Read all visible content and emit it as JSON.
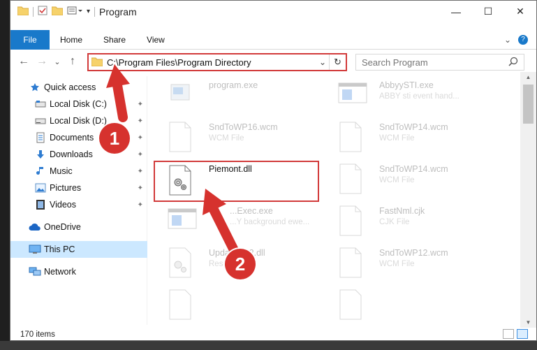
{
  "window": {
    "title": "Program",
    "minimize_glyph": "—",
    "maximize_glyph": "☐",
    "close_glyph": "✕"
  },
  "ribbon": {
    "tabs": [
      "File",
      "Home",
      "Share",
      "View"
    ],
    "collapse_glyph": "⌄",
    "help_glyph": "?"
  },
  "nav": {
    "back_glyph": "←",
    "forward_glyph": "→",
    "recent_glyph": "⌄",
    "up_glyph": "↑",
    "address": "C:\\Program Files\\Program Directory",
    "dropdown_glyph": "⌄",
    "refresh_glyph": "↻",
    "search_placeholder": "Search Program"
  },
  "sidebar": {
    "pin_glyph": "📌",
    "items": [
      {
        "label": "Quick access",
        "icon": "star-icon"
      },
      {
        "label": "Local Disk (C:)",
        "icon": "drive-icon",
        "pinned": true
      },
      {
        "label": "Local Disk (D:)",
        "icon": "drive-icon",
        "pinned": true
      },
      {
        "label": "Documents",
        "icon": "documents-icon",
        "pinned": true
      },
      {
        "label": "Downloads",
        "icon": "download-icon",
        "pinned": true
      },
      {
        "label": "Music",
        "icon": "music-icon",
        "pinned": true
      },
      {
        "label": "Pictures",
        "icon": "pictures-icon",
        "pinned": true
      },
      {
        "label": "Videos",
        "icon": "videos-icon",
        "pinned": true
      },
      {
        "label": "OneDrive",
        "icon": "cloud-icon"
      },
      {
        "label": "This PC",
        "icon": "pc-icon",
        "selected": true
      },
      {
        "label": "Network",
        "icon": "network-icon"
      }
    ]
  },
  "files": [
    {
      "name": "program.exe",
      "desc": "",
      "icon": "exe-icon"
    },
    {
      "name": "AbbyySTI.exe",
      "desc": "ABBY sti event hand...",
      "icon": "app-window-icon"
    },
    {
      "name": "SndToWP16.wcm",
      "desc": "WCM File",
      "icon": "file-icon"
    },
    {
      "name": "SndToWP14.wcm",
      "desc": "WCM File",
      "icon": "file-icon"
    },
    {
      "name": "Piemont.dll",
      "desc": "",
      "icon": "dll-gear-icon"
    },
    {
      "name": "SndToWP14.wcm",
      "desc": "WCM File",
      "icon": "file-icon"
    },
    {
      "name": "...Exec.exe",
      "desc": "...Y background ewe...",
      "icon": "app-window-icon"
    },
    {
      "name": "FastNml.cjk",
      "desc": "CJK File",
      "icon": "file-icon"
    },
    {
      "name": "Update...42.dll",
      "desc": "Resource...",
      "icon": "dll-gear-icon"
    },
    {
      "name": "SndToWP12.wcm",
      "desc": "WCM File",
      "icon": "file-icon"
    }
  ],
  "status": {
    "item_count": "170 items"
  },
  "annotations": {
    "step1": "1",
    "step2": "2"
  },
  "colors": {
    "accent": "#1979ca",
    "highlight": "#d23a3a",
    "selection": "#cce8ff"
  }
}
